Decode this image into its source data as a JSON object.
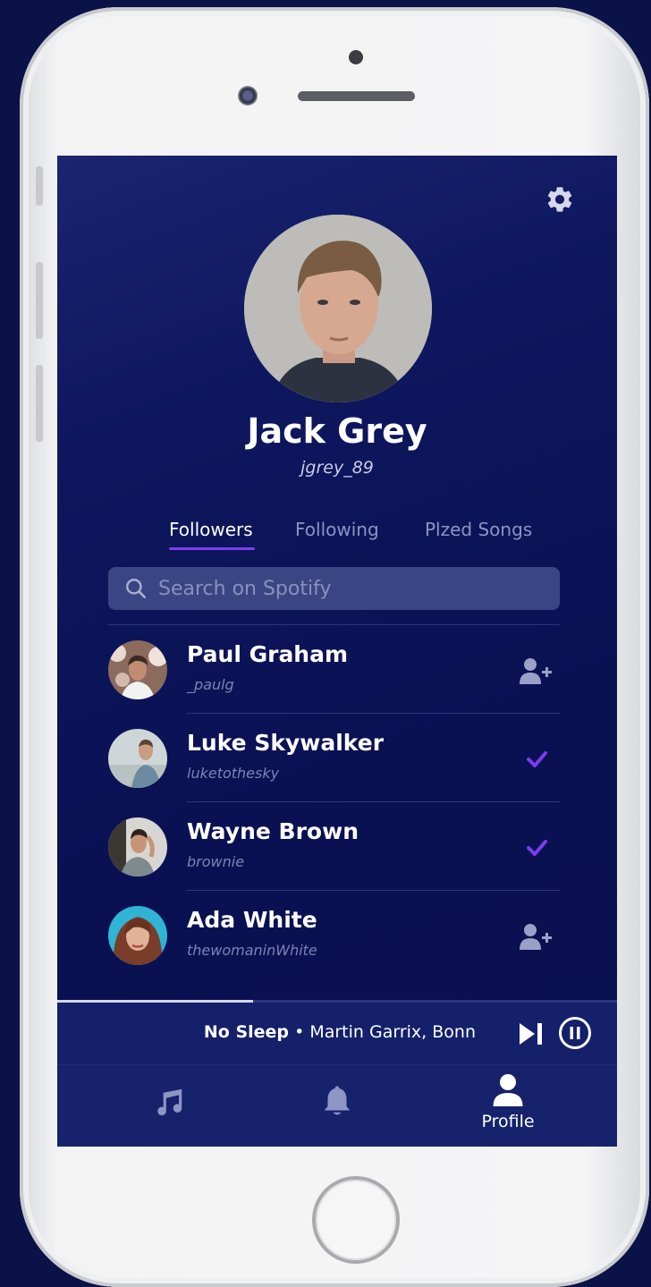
{
  "profile": {
    "name": "Jack Grey",
    "handle": "jgrey_89"
  },
  "tabs": [
    {
      "label": "Followers",
      "active": true
    },
    {
      "label": "Following",
      "active": false
    },
    {
      "label": "Plzed Songs",
      "active": false
    }
  ],
  "search": {
    "placeholder": "Search on Spotify",
    "value": ""
  },
  "followers": [
    {
      "name": "Paul Graham",
      "username": "_paulg",
      "action": "add-user-icon"
    },
    {
      "name": "Luke Skywalker",
      "username": "luketothesky",
      "action": "check-icon"
    },
    {
      "name": "Wayne Brown",
      "username": "brownie",
      "action": "check-icon"
    },
    {
      "name": "Ada White",
      "username": "thewomaninWhite",
      "action": "add-user-icon"
    }
  ],
  "player": {
    "song": "No Sleep",
    "separator": " • ",
    "artists": "Martin Garrix, Bonn",
    "progress": 0.35
  },
  "nav": [
    {
      "icon": "music-note-icon",
      "label": ""
    },
    {
      "icon": "bell-icon",
      "label": ""
    },
    {
      "icon": "profile-icon",
      "label": "Profile",
      "active": true
    }
  ],
  "colors": {
    "background": "#0b1248",
    "accent": "#7d3cf0",
    "check": "#7d3cf0"
  }
}
